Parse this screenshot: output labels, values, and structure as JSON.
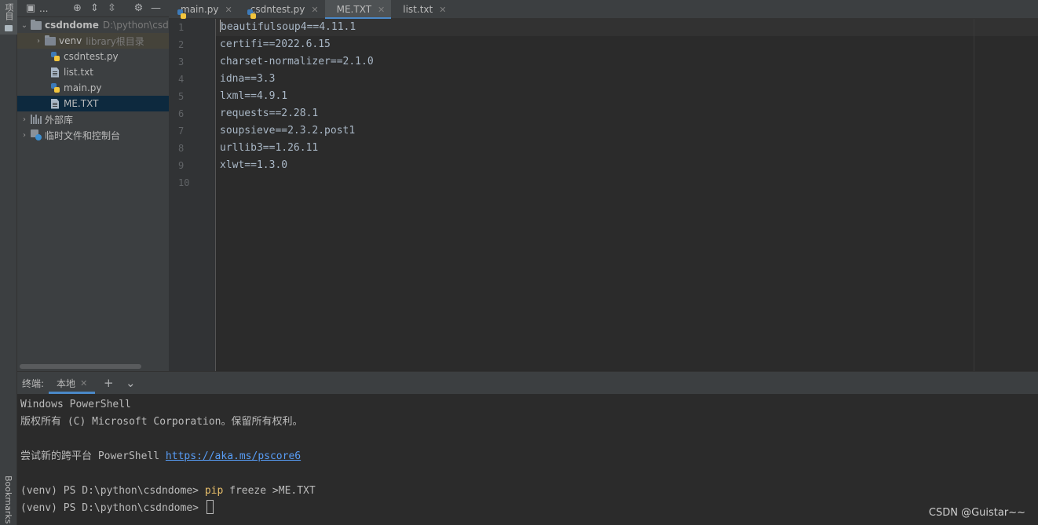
{
  "toolstrip": {
    "project_label": "项目",
    "bookmarks_label": "Bookmarks"
  },
  "project": {
    "header_label": "...",
    "tree": [
      {
        "name": "csdndome",
        "hint": "D:\\python\\csd",
        "type": "root"
      },
      {
        "name": "venv",
        "hint": "library根目录",
        "type": "folder"
      },
      {
        "name": "csdntest.py",
        "type": "py"
      },
      {
        "name": "list.txt",
        "type": "txt"
      },
      {
        "name": "main.py",
        "type": "py"
      },
      {
        "name": "ME.TXT",
        "type": "txt"
      },
      {
        "name": "外部库",
        "type": "lib"
      },
      {
        "name": "临时文件和控制台",
        "type": "scratch"
      }
    ]
  },
  "tabs": [
    {
      "label": "main.py",
      "type": "py"
    },
    {
      "label": "csdntest.py",
      "type": "py"
    },
    {
      "label": "ME.TXT",
      "type": "txt",
      "active": true
    },
    {
      "label": "list.txt",
      "type": "txt"
    }
  ],
  "editor": {
    "line_numbers": [
      "1",
      "2",
      "3",
      "4",
      "5",
      "6",
      "7",
      "8",
      "9",
      "10"
    ],
    "lines": [
      "beautifulsoup4==4.11.1",
      "certifi==2022.6.15",
      "charset-normalizer==2.1.0",
      "idna==3.3",
      "lxml==4.9.1",
      "requests==2.28.1",
      "soupsieve==2.3.2.post1",
      "urllib3==1.26.11",
      "xlwt==1.3.0",
      ""
    ]
  },
  "terminal": {
    "label": "终端:",
    "tab_label": "本地",
    "lines": {
      "l1": "Windows PowerShell",
      "l2": "版权所有 (C) Microsoft Corporation。保留所有权利。",
      "l3_prefix": "尝试新的跨平台 PowerShell ",
      "l3_link": "https://aka.ms/pscore6",
      "l4_prompt": "(venv) PS D:\\python\\csdndome> ",
      "l4_cmd": "pip",
      "l4_rest": " freeze >ME.TXT",
      "l5_prompt": "(venv) PS D:\\python\\csdndome> "
    }
  },
  "watermark": "CSDN @Guistar~~"
}
